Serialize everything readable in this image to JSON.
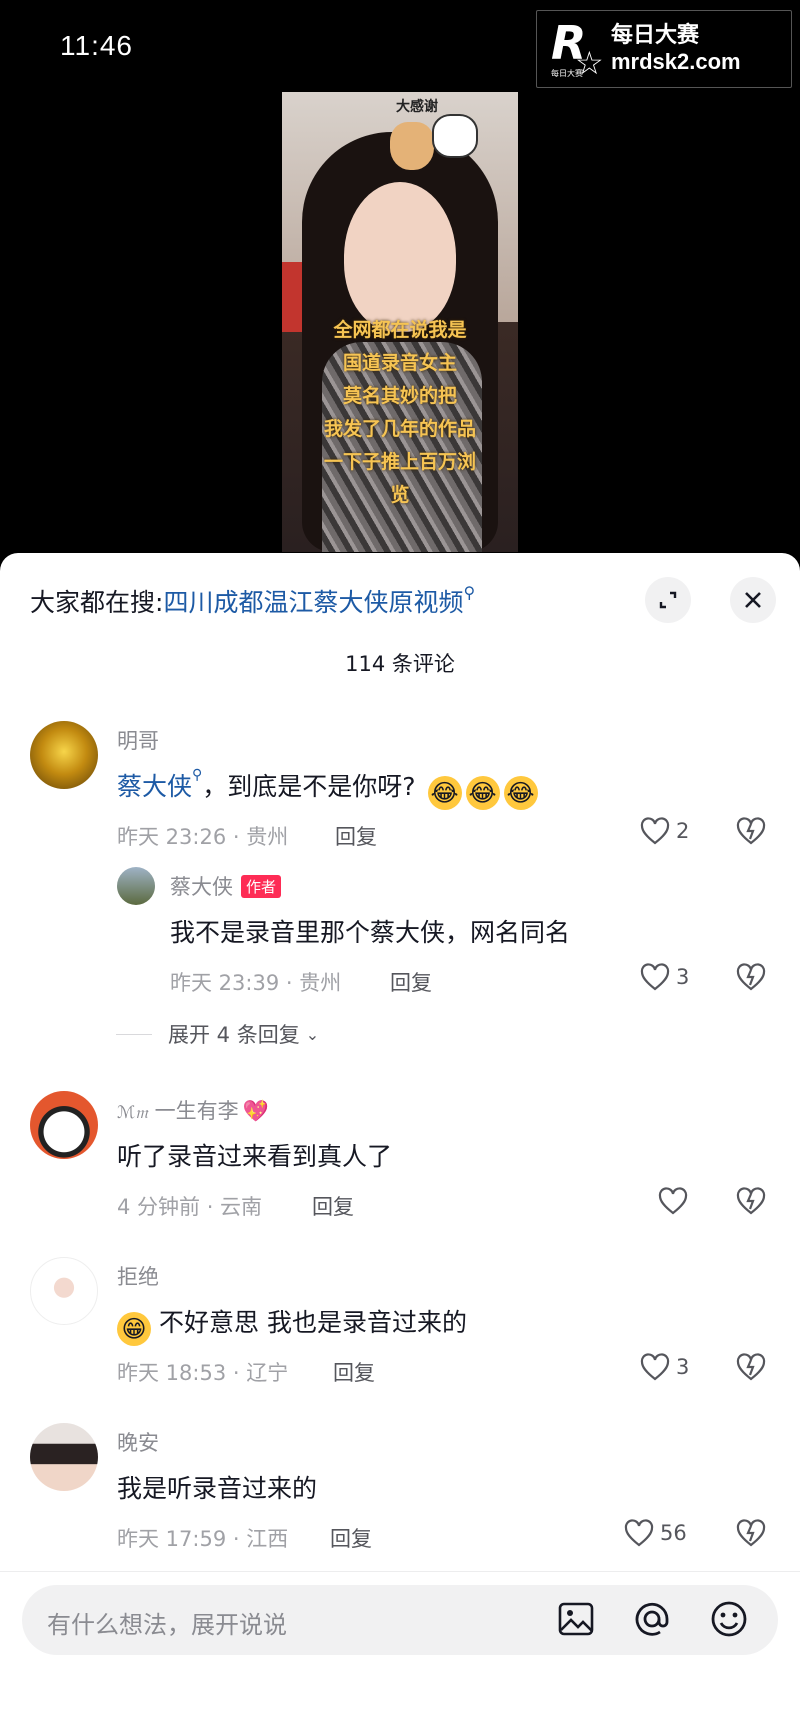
{
  "status": {
    "time": "11:46"
  },
  "watermark": {
    "cn": "每日大赛",
    "url": "mrdsk2.com",
    "logo_letter": "R",
    "logo_small": "每日大赛"
  },
  "video": {
    "sticker": "大感谢",
    "caption_lines": [
      "全网都在说我是",
      "国道录音女主",
      "莫名其妙的把",
      "我发了几年的作品",
      "一下子推上百万浏",
      "览"
    ]
  },
  "sheet": {
    "search_prefix": "大家都在搜:",
    "search_keyword": "四川成都温江蔡大侠原视频",
    "comment_count": "114 条评论"
  },
  "comments": [
    {
      "name": "明哥",
      "mention": "蔡大侠",
      "text": "，到底是不是你呀?",
      "emoji": "😂😂😂",
      "meta": "昨天 23:26 · 贵州",
      "reply_label": "回复",
      "likes": "2",
      "reply": {
        "name": "蔡大侠",
        "badge": "作者",
        "text": "我不是录音里那个蔡大侠，网名同名",
        "meta": "昨天 23:39 · 贵州",
        "reply_label": "回复",
        "likes": "3"
      },
      "expand_label": "展开 4 条回复"
    },
    {
      "name": "一生有李",
      "name_prefix": "ℳ𝔪",
      "text": "听了录音过来看到真人了",
      "meta": "4 分钟前 · 云南",
      "reply_label": "回复",
      "likes": ""
    },
    {
      "name": "拒绝",
      "emoji": "😁",
      "text": "不好意思 我也是录音过来的",
      "meta": "昨天 18:53 · 辽宁",
      "reply_label": "回复",
      "likes": "3"
    },
    {
      "name": "晚安",
      "text": "我是听录音过来的",
      "meta": "昨天 17:59 · 江西",
      "reply_label": "回复",
      "likes": "56"
    }
  ],
  "input": {
    "placeholder": "有什么想法，展开说说"
  },
  "icons": [
    "search-mag-icon",
    "expand-icon",
    "close-icon",
    "heart-icon",
    "broken-heart-icon",
    "image-icon",
    "at-icon",
    "emoji-icon"
  ],
  "colors": {
    "link": "#1d5aa5",
    "badge": "#fe2c55",
    "caption": "#f6c453"
  }
}
